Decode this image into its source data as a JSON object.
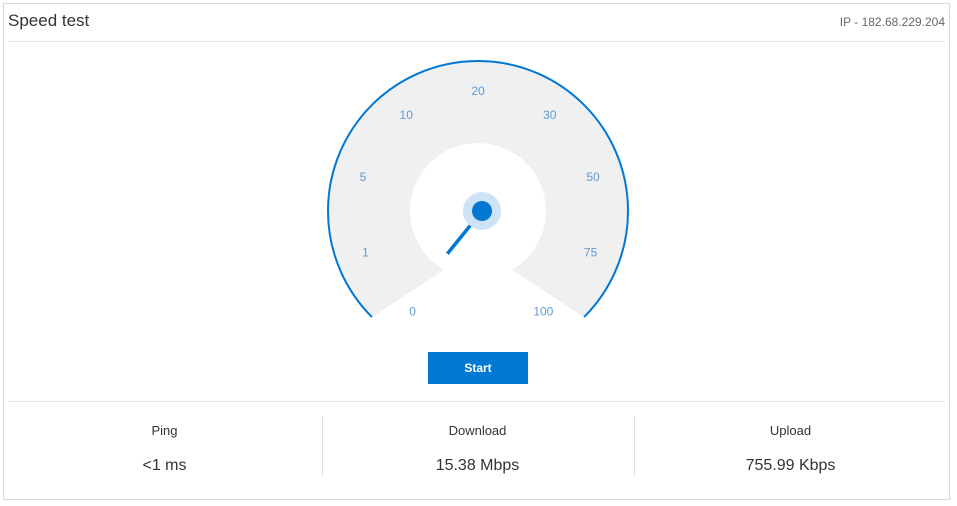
{
  "header": {
    "title": "Speed test",
    "ip": "IP - 182.68.229.204"
  },
  "gauge": {
    "tick_labels": [
      "0",
      "1",
      "5",
      "10",
      "20",
      "30",
      "50",
      "75",
      "100"
    ],
    "needle_value": 0,
    "colors": {
      "accent": "#0078d4",
      "track": "#f0f0f0",
      "label": "#5b9bd5",
      "hub_halo": "#cfe3f6"
    }
  },
  "start_button": {
    "label": "Start"
  },
  "stats": [
    {
      "label": "Ping",
      "value": "<1 ms"
    },
    {
      "label": "Download",
      "value": "15.38 Mbps"
    },
    {
      "label": "Upload",
      "value": "755.99 Kbps"
    }
  ]
}
